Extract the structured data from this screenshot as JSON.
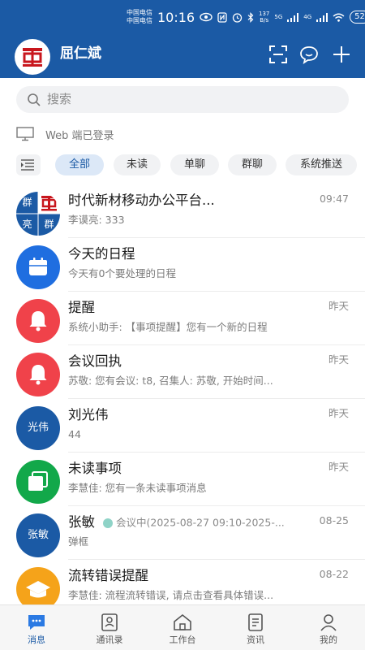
{
  "status_bar": {
    "carrier_1": "中国电信",
    "carrier_2": "中国电信",
    "time": "10:16",
    "speed_value": "137",
    "speed_unit": "B/s",
    "net_1": "5G",
    "net_2": "4G",
    "battery": "52"
  },
  "header": {
    "username": "屈仁斌"
  },
  "search": {
    "placeholder": "搜索"
  },
  "web_login": {
    "text": "Web 端已登录"
  },
  "filters": [
    {
      "label": "全部",
      "active": true
    },
    {
      "label": "未读",
      "active": false
    },
    {
      "label": "单聊",
      "active": false
    },
    {
      "label": "群聊",
      "active": false
    },
    {
      "label": "系统推送",
      "active": false
    }
  ],
  "messages": [
    {
      "title": "时代新材移动办公平台...",
      "subtitle": "李谟亮: 333",
      "time": "09:47",
      "avatar": "group",
      "group_chars": [
        "群",
        "中",
        "亮",
        "群"
      ]
    },
    {
      "title": "今天的日程",
      "subtitle": "今天有0个要处理的日程",
      "time": "",
      "avatar": "calendar-icon",
      "color": "#1f6ee0"
    },
    {
      "title": "提醒",
      "subtitle": "系统小助手: 【事项提醒】您有一个新的日程",
      "time": "昨天",
      "avatar": "bell-icon",
      "color": "#f0424a"
    },
    {
      "title": "会议回执",
      "subtitle": "苏敬: 您有会议: t8, 召集人: 苏敬, 开始时间...",
      "time": "昨天",
      "avatar": "bell-icon",
      "color": "#f0424a"
    },
    {
      "title": "刘光伟",
      "subtitle": "44",
      "time": "昨天",
      "avatar": "text",
      "avatar_text": "光伟",
      "color": "#1b5aa5"
    },
    {
      "title": "未读事项",
      "subtitle": "李慧佳: 您有一条未读事项消息",
      "time": "昨天",
      "avatar": "copy-icon",
      "color": "#12a84a"
    },
    {
      "title": "张敏",
      "subtitle": "弹框",
      "time": "08-25",
      "avatar": "text",
      "avatar_text": "张敏",
      "color": "#1b5aa5",
      "meeting": "会议中(2025-08-27 09:10-2025-..."
    },
    {
      "title": "流转错误提醒",
      "subtitle": "李慧佳: 流程流转错误, 请点击查看具体错误...",
      "time": "08-22",
      "avatar": "hat-icon",
      "color": "#f5a31a"
    }
  ],
  "bottom_nav": [
    {
      "label": "消息",
      "icon": "chat-icon",
      "active": true
    },
    {
      "label": "通讯录",
      "icon": "contacts-icon",
      "active": false
    },
    {
      "label": "工作台",
      "icon": "home-icon",
      "active": false
    },
    {
      "label": "资讯",
      "icon": "news-icon",
      "active": false
    },
    {
      "label": "我的",
      "icon": "person-icon",
      "active": false
    }
  ],
  "colors": {
    "brand": "#1b5aa5",
    "chip_active_bg": "#dce8f7"
  }
}
